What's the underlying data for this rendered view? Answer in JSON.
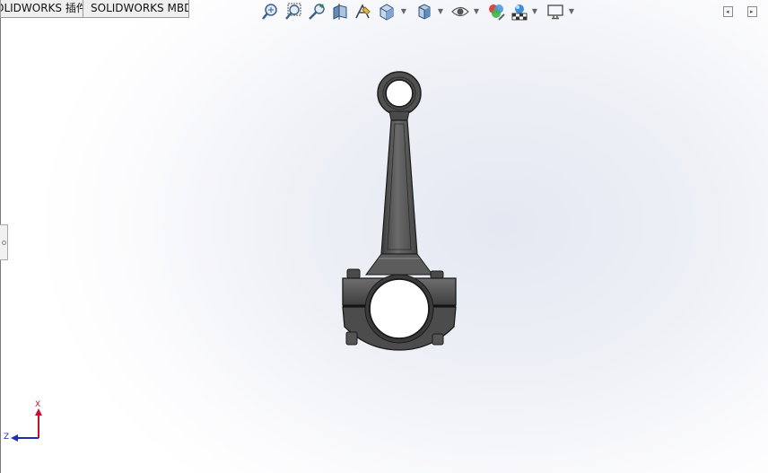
{
  "tabs": [
    {
      "label": "OLIDWORKS 插件"
    },
    {
      "label": "SOLIDWORKS MBD"
    }
  ],
  "heads_up_toolbar": {
    "buttons": [
      {
        "icon": "zoom-to-fit-icon"
      },
      {
        "icon": "zoom-to-area-icon"
      },
      {
        "icon": "previous-view-icon"
      },
      {
        "icon": "section-view-icon"
      },
      {
        "icon": "dynamic-annotation-views-icon"
      },
      {
        "icon": "view-orientation-icon"
      },
      {
        "icon": "display-style-icon"
      },
      {
        "icon": "hide-show-items-icon"
      },
      {
        "icon": "edit-appearance-icon"
      },
      {
        "icon": "apply-scene-icon"
      },
      {
        "icon": "view-settings-icon"
      }
    ]
  },
  "triad": {
    "x_label": "X",
    "z_label": "Z"
  },
  "colors": {
    "x_axis": "#c8102e",
    "z_axis": "#1d2fb0",
    "part": "#5a5a5a"
  }
}
